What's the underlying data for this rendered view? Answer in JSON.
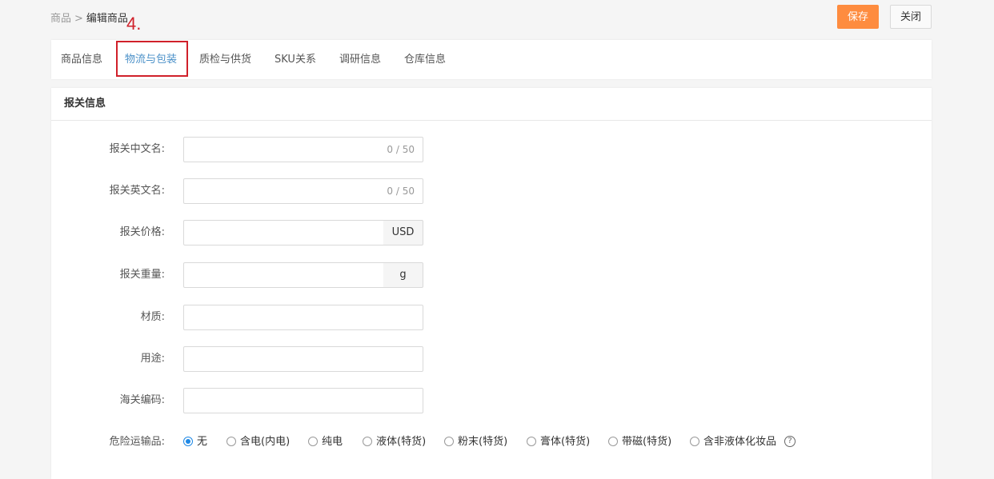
{
  "breadcrumb": {
    "root": "商品",
    "separator": ">",
    "current": "编辑商品"
  },
  "annotation": {
    "step_label": "4."
  },
  "header_buttons": {
    "save_label": "保存",
    "close_label": "关闭",
    "save_color": "#fe8c3f"
  },
  "tabs": [
    {
      "label": "商品信息",
      "active": false
    },
    {
      "label": "物流与包装",
      "active": true
    },
    {
      "label": "质检与供货",
      "active": false
    },
    {
      "label": "SKU关系",
      "active": false
    },
    {
      "label": "调研信息",
      "active": false
    },
    {
      "label": "仓库信息",
      "active": false
    }
  ],
  "section": {
    "title": "报关信息",
    "fields": {
      "cn_name": {
        "label": "报关中文名:",
        "value": "",
        "counter": "0 / 50"
      },
      "en_name": {
        "label": "报关英文名:",
        "value": "",
        "counter": "0 / 50"
      },
      "price": {
        "label": "报关价格:",
        "value": "",
        "unit": "USD"
      },
      "weight": {
        "label": "报关重量:",
        "value": "",
        "unit": "g"
      },
      "material": {
        "label": "材质:",
        "value": ""
      },
      "usage": {
        "label": "用途:",
        "value": ""
      },
      "hs_code": {
        "label": "海关编码:",
        "value": ""
      }
    },
    "dangerous": {
      "label": "危险运输品:",
      "options": [
        {
          "label": "无",
          "checked": true
        },
        {
          "label": "含电(内电)",
          "checked": false
        },
        {
          "label": "纯电",
          "checked": false
        },
        {
          "label": "液体(特货)",
          "checked": false
        },
        {
          "label": "粉末(特货)",
          "checked": false
        },
        {
          "label": "膏体(特货)",
          "checked": false
        },
        {
          "label": "带磁(特货)",
          "checked": false
        },
        {
          "label": "含非液体化妆品",
          "checked": false
        }
      ],
      "help_icon": "question-circle-icon"
    }
  },
  "colors": {
    "accent_blue": "#1e88e5",
    "active_tab": "#4a90c8",
    "annotation_red": "#d0202a"
  }
}
